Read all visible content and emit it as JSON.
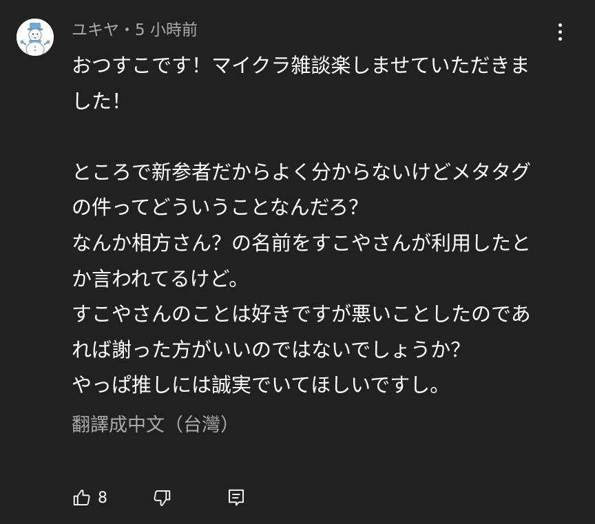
{
  "comment": {
    "author": "ユキヤ",
    "separator": "・",
    "time": "5 小時前",
    "lines": [
      "おつすこです！マイクラ雑談楽しませていただきま",
      "した！",
      "",
      "ところで新参者だからよく分からないけどメタタグ",
      "の件ってどういうことなんだろ？",
      "なんか相方さん？の名前をすこやさんが利用したと",
      "か言われてるけど。",
      "すこやさんのことは好きですが悪いことしたのであ",
      "れば謝った方がいいのではないでしょうか？",
      "やっぱ推しには誠実でいてほしいですし。"
    ],
    "translate_label": "翻譯成中文（台灣）",
    "like_count": "8"
  },
  "icons": {
    "avatar": "snowman-avatar-icon",
    "menu": "more-vert-icon",
    "like": "thumb-up-icon",
    "dislike": "thumb-down-icon",
    "reply": "comment-reply-icon"
  },
  "colors": {
    "background": "#212121",
    "primary_text": "#ffffff",
    "secondary_text": "#aaaaaa"
  }
}
